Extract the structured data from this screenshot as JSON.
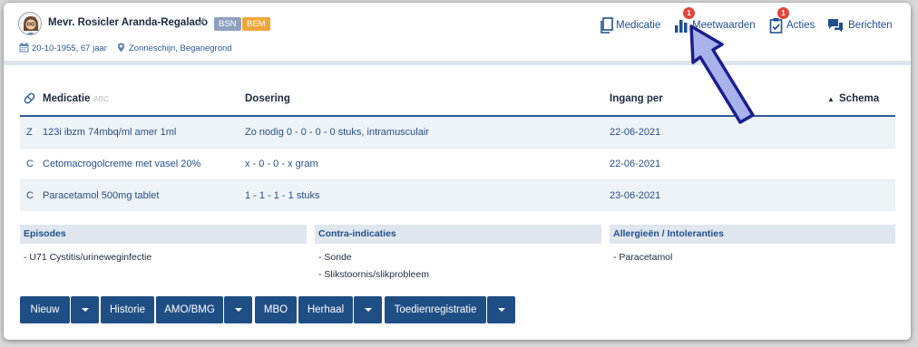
{
  "patient": {
    "name": "Mevr. Rosicler Aranda-Regalado",
    "badges": [
      "BSN",
      "BEM"
    ],
    "birth": "20-10-1955, 67 jaar",
    "location": "Zonneschijn, Beganegrond"
  },
  "nav": {
    "items": [
      {
        "label": "Medicatie",
        "icon": "pages-icon"
      },
      {
        "label": "Meetwaarden",
        "icon": "bar-chart-icon",
        "badge": "1"
      },
      {
        "label": "Acties",
        "icon": "clipboard-check-icon",
        "badge": "1"
      },
      {
        "label": "Berichten",
        "icon": "chat-bubbles-icon"
      }
    ]
  },
  "table": {
    "headers": {
      "medicatie": "Medicatie",
      "abc": "ABC",
      "dosering": "Dosering",
      "ingang": "Ingang per",
      "schema": "Schema"
    },
    "rows": [
      {
        "code": "Z",
        "name": "123i ibzm 74mbq/ml amer 1ml",
        "dosage": "Zo nodig 0 - 0 - 0 - 0 stuks, intramusculair",
        "date": "22-06-2021"
      },
      {
        "code": "C",
        "name": "Cetomacrogolcreme met vasel 20%",
        "dosage": "x - 0 - 0 - x gram",
        "date": "22-06-2021"
      },
      {
        "code": "C",
        "name": "Paracetamol 500mg tablet",
        "dosage": "1 - 1 - 1 - 1 stuks",
        "date": "23-06-2021"
      }
    ]
  },
  "panels": {
    "episodes": {
      "title": "Episodes",
      "items": [
        "- U71 Cystitis/urineweginfectie"
      ]
    },
    "contra": {
      "title": "Contra-indicaties",
      "items": [
        "- Sonde",
        "- Slikstoornis/slikprobleem"
      ]
    },
    "allergies": {
      "title": "Allergieën / Intoleranties",
      "items": [
        "- Paracetamol"
      ]
    }
  },
  "buttons": {
    "nieuw": "Nieuw",
    "historie": "Historie",
    "amo": "AMO/BMG",
    "mbo": "MBO",
    "herhaal": "Herhaal",
    "toedien": "Toedienregistratie"
  },
  "colors": {
    "primary": "#1f4e85",
    "badge_bsn": "#8ea2be",
    "badge_bem": "#f0a63a",
    "notification": "#e04536",
    "arrow_fill": "#a9b2ea",
    "arrow_stroke": "#1a1f8c"
  }
}
